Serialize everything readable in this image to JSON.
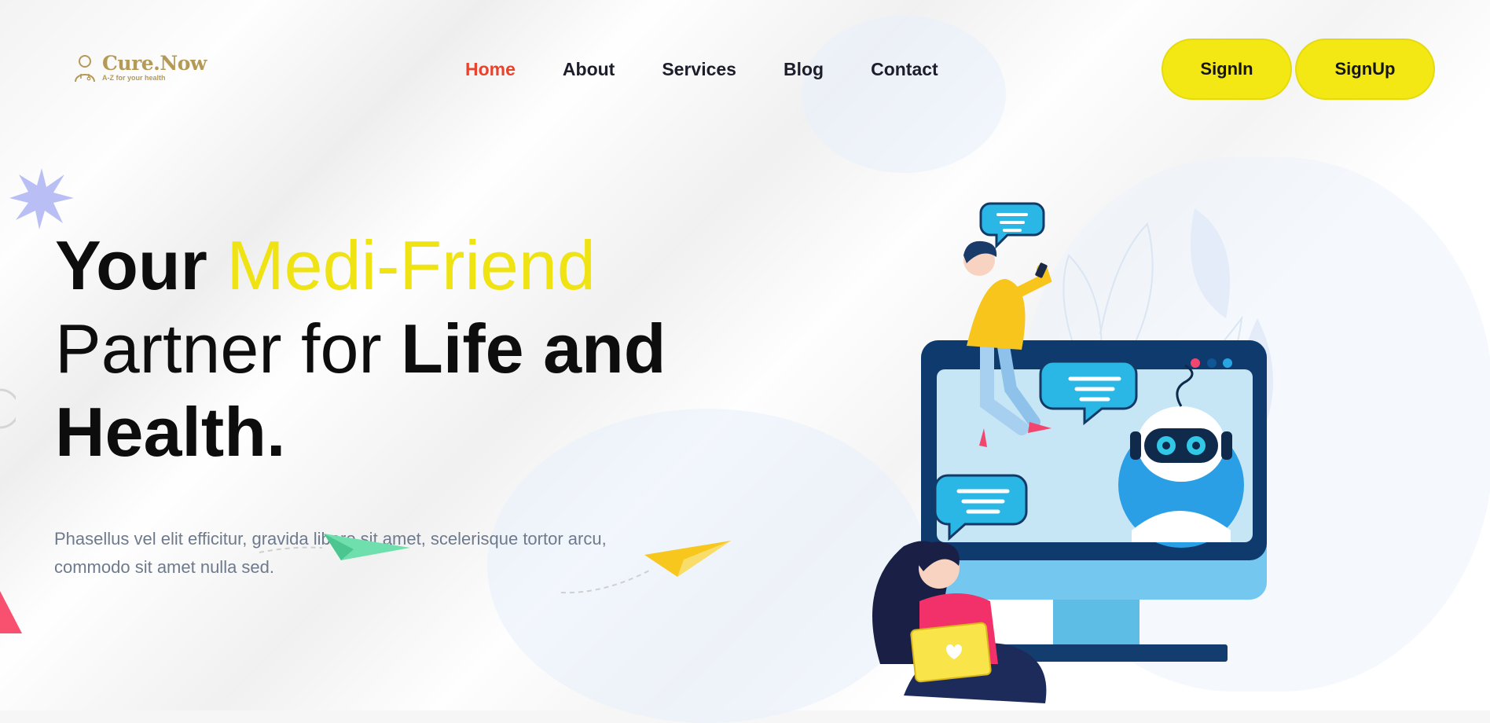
{
  "brand": {
    "name": "Cure.Now",
    "tagline": "A-Z for your health",
    "color": "#b49a55"
  },
  "nav": {
    "items": [
      {
        "label": "Home",
        "active": true
      },
      {
        "label": "About",
        "active": false
      },
      {
        "label": "Services",
        "active": false
      },
      {
        "label": "Blog",
        "active": false
      },
      {
        "label": "Contact",
        "active": false
      }
    ],
    "active_color": "#e8432d"
  },
  "auth": {
    "signin_label": "SignIn",
    "signup_label": "SignUp",
    "button_color": "#f3e814"
  },
  "hero": {
    "title_part1": "Your ",
    "title_highlight": "Medi-Friend",
    "title_part2": "Partner for ",
    "title_bold": "Life and",
    "title_part3": "Health.",
    "highlight_color": "#f0e314",
    "subtitle": "Phasellus vel elit efficitur, gravida libero sit amet, scelerisque tortor arcu, commodo sit amet nulla sed."
  }
}
